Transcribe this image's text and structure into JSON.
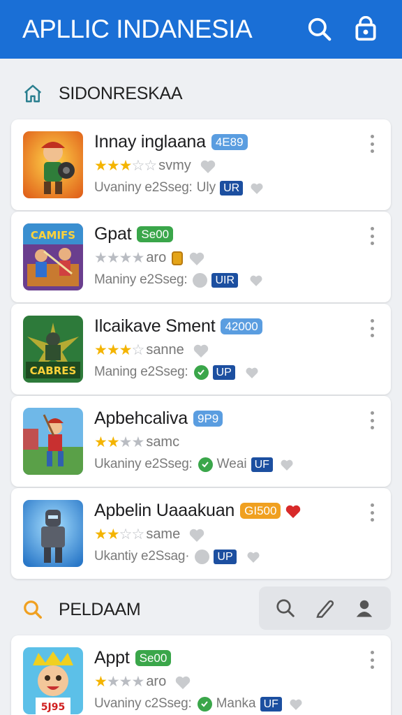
{
  "appbar": {
    "title": "APLLIC INDANESIA",
    "search_icon": "search-icon",
    "bag_icon": "shopping-bag-icon"
  },
  "colors": {
    "primary": "#1a6fd6",
    "star": "#f4b400",
    "up_tag": "#1c4fa0",
    "check": "#3aa64a"
  },
  "section1": {
    "title": "SIDONRESKAA",
    "icon": "home-icon"
  },
  "section2": {
    "title": "PELDAAM",
    "icon": "search-icon",
    "tools": [
      "search-icon",
      "pencil-icon",
      "user-icon"
    ]
  },
  "apps": [
    {
      "title": "Innay inglaana",
      "badge": "4E89",
      "stars": 2.5,
      "rate_text": "svmy",
      "meta": "Uvaniny e2Sseg:",
      "meta_extra": "Uly",
      "tag": "UR"
    },
    {
      "title": "Gpat",
      "badge": "Se00",
      "stars": 0,
      "rate_text": "aro",
      "meta": "Maniny e2Sseg:",
      "meta_extra": "",
      "tag": "UIR"
    },
    {
      "title": "Ilcaikave Sment",
      "badge": "42000",
      "stars": 2.5,
      "rate_text": "sanne",
      "meta": "Maning e2Sseg:",
      "meta_extra": "",
      "tag": "UP"
    },
    {
      "title": "Apbehcaliva",
      "badge": "9P9",
      "stars": 2,
      "rate_text": "samc",
      "meta": "Ukaniny e2Sseg:",
      "meta_extra": "Weai",
      "tag": "UF"
    },
    {
      "title": "Apbelin Uaaakuan",
      "badge": "GI500",
      "stars": 2,
      "rate_text": "same",
      "meta": "Ukantiy e2Ssag·",
      "meta_extra": "",
      "tag": "UP"
    },
    {
      "title": "Appt",
      "badge": "Se00",
      "stars": 1,
      "rate_text": "aro",
      "meta": "Uvaniny c2Sseg:",
      "meta_extra": "Manka",
      "tag": "UF"
    }
  ]
}
